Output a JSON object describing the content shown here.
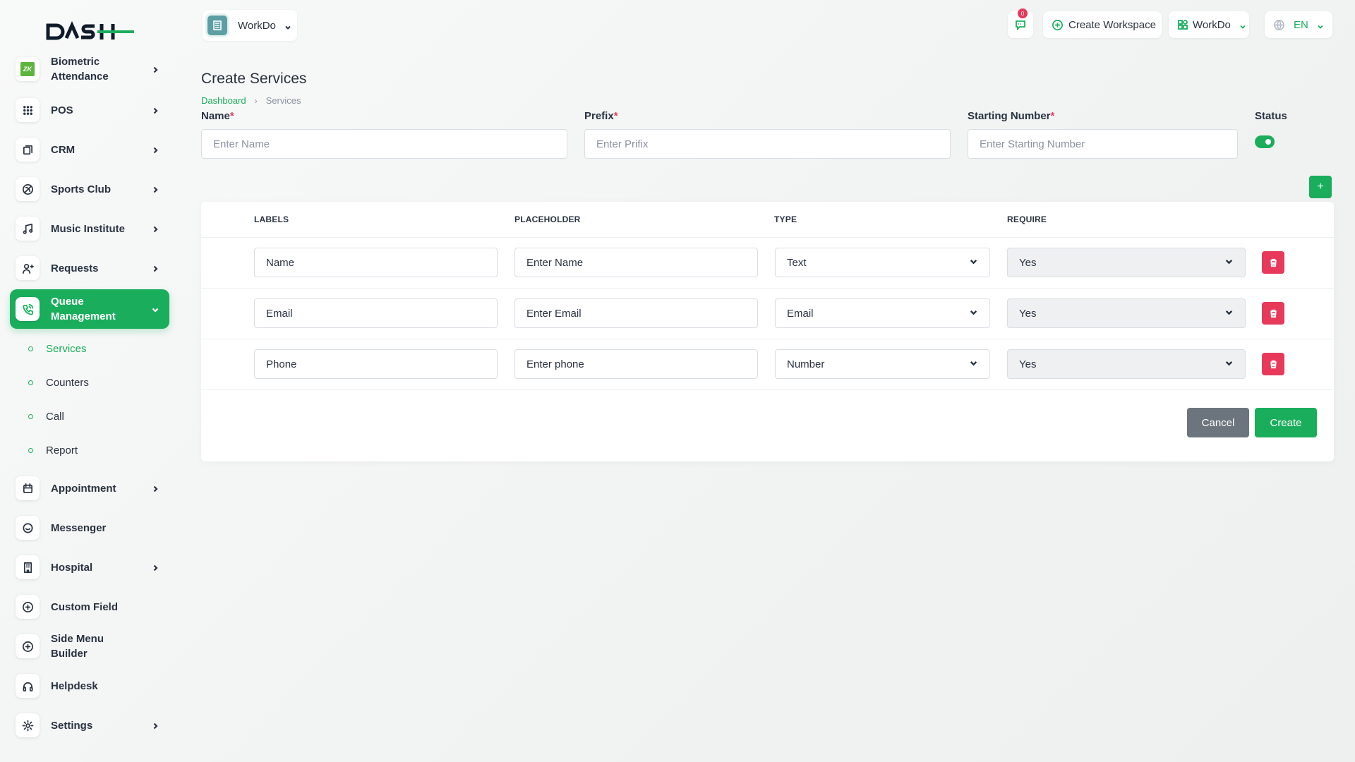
{
  "sidebar": {
    "logo_text": "DASH",
    "items": [
      {
        "label": "Biometric Attendance",
        "icon": "zk-icon",
        "has_chevron": true
      },
      {
        "label": "POS",
        "icon": "grid-icon",
        "has_chevron": true
      },
      {
        "label": "CRM",
        "icon": "crm-icon",
        "has_chevron": true
      },
      {
        "label": "Sports Club",
        "icon": "ball-icon",
        "has_chevron": true
      },
      {
        "label": "Music Institute",
        "icon": "music-icon",
        "has_chevron": true
      },
      {
        "label": "Requests",
        "icon": "user-plus-icon",
        "has_chevron": true
      },
      {
        "label": "Queue Management",
        "icon": "phone-icon",
        "has_chevron": true,
        "active": true
      },
      {
        "label": "Appointment",
        "icon": "calendar-icon",
        "has_chevron": true
      },
      {
        "label": "Messenger",
        "icon": "chat-icon",
        "has_chevron": false
      },
      {
        "label": "Hospital",
        "icon": "building-icon",
        "has_chevron": true
      },
      {
        "label": "Custom Field",
        "icon": "plus-circle-icon",
        "has_chevron": false
      },
      {
        "label": "Side Menu Builder",
        "icon": "plus-circle-icon",
        "has_chevron": false
      },
      {
        "label": "Helpdesk",
        "icon": "headphones-icon",
        "has_chevron": false
      },
      {
        "label": "Settings",
        "icon": "gear-icon",
        "has_chevron": true
      }
    ],
    "subitems": [
      {
        "label": "Services",
        "active": true
      },
      {
        "label": "Counters"
      },
      {
        "label": "Call"
      },
      {
        "label": "Report"
      }
    ]
  },
  "header": {
    "workspace_name": "WorkDo",
    "notification_count": "0",
    "create_workspace_label": "Create Workspace",
    "workspace_menu_label": "WorkDo",
    "language": "EN"
  },
  "main": {
    "title": "Create Services",
    "breadcrumb": {
      "home": "Dashboard",
      "current": "Services"
    },
    "form": {
      "name_label": "Name",
      "name_placeholder": "Enter Name",
      "prefix_label": "Prefix",
      "prefix_placeholder": "Enter Prifix",
      "starting_number_label": "Starting Number",
      "starting_number_placeholder": "Enter Starting Number",
      "status_label": "Status",
      "required_mark": "*"
    },
    "table": {
      "headers": [
        "LABELS",
        "PLACEHOLDER",
        "TYPE",
        "REQUIRE"
      ],
      "rows": [
        {
          "label": "Name",
          "placeholder": "Enter Name",
          "type": "Text",
          "require": "Yes"
        },
        {
          "label": "Email",
          "placeholder": "Enter Email",
          "type": "Email",
          "require": "Yes"
        },
        {
          "label": "Phone",
          "placeholder": "Enter phone",
          "type": "Number",
          "require": "Yes"
        }
      ]
    },
    "add_row_label": "+",
    "cancel_label": "Cancel",
    "create_label": "Create"
  },
  "colors": {
    "accent": "#1aae5c",
    "danger": "#e8395b",
    "secondary": "#6c757d"
  }
}
